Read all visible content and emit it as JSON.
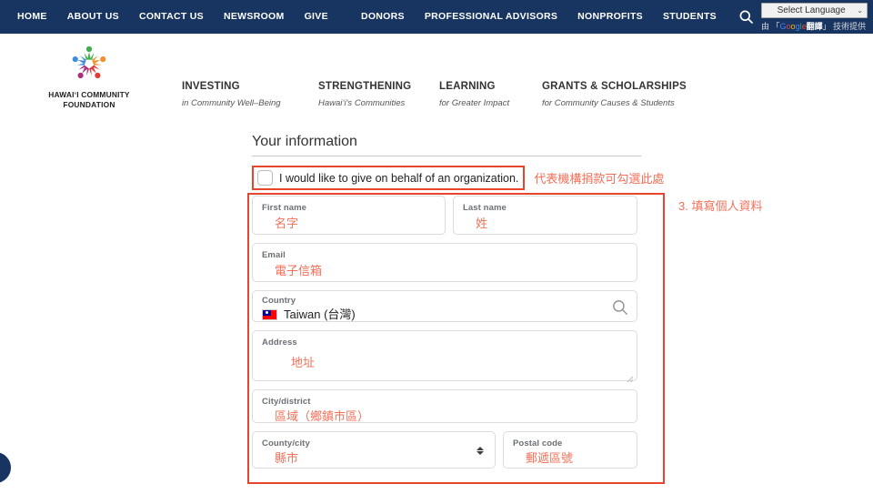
{
  "topnav": {
    "left_links": [
      "HOME",
      "ABOUT US",
      "CONTACT US",
      "NEWSROOM",
      "GIVE"
    ],
    "right_links": [
      "DONORS",
      "PROFESSIONAL ADVISORS",
      "NONPROFITS",
      "STUDENTS"
    ],
    "search_icon": "search-icon",
    "language": {
      "selected": "Select Language",
      "chevron": "⌄",
      "credit_prefix": "由 「",
      "credit_google": "Google",
      "credit_translate": "翻譯",
      "credit_suffix": "」 技術提供"
    },
    "bg_color": "#173560"
  },
  "header": {
    "logo": {
      "icon": "community-circle-logo",
      "line1": "HAWAIʻI COMMUNITY",
      "line2": "FOUNDATION"
    },
    "mainnav": [
      {
        "title": "INVESTING",
        "subtitle": "in Community Well–Being"
      },
      {
        "title": "STRENGTHENING",
        "subtitle": "Hawaiʻi's Communities"
      },
      {
        "title": "LEARNING",
        "subtitle": "for Greater Impact"
      },
      {
        "title": "GRANTS & SCHOLARSHIPS",
        "subtitle": "for Community Causes & Students"
      }
    ]
  },
  "form": {
    "section_title": "Your information",
    "organization": {
      "checkbox_checked": false,
      "label": "I would like to give on behalf of an organization.",
      "annotation": "代表機構捐款可勾選此處"
    },
    "step_annotation": "3. 填寫個人資料",
    "fields": {
      "first_name": {
        "label": "First name",
        "value": "名字"
      },
      "last_name": {
        "label": "Last name",
        "value": "姓"
      },
      "email": {
        "label": "Email",
        "value": "電子信箱"
      },
      "country": {
        "label": "Country",
        "value": "Taiwan (台灣)",
        "flag": "taiwan-flag-icon",
        "icon": "search-icon"
      },
      "address": {
        "label": "Address",
        "value": "地址",
        "icon": "resize-grip-icon"
      },
      "city_district": {
        "label": "City/district",
        "value": "區域（鄉鎮市區）"
      },
      "county_city": {
        "label": "County/city",
        "value": "縣市",
        "icon": "spinner-arrows-icon"
      },
      "postal_code": {
        "label": "Postal code",
        "value": "郵遞區號"
      }
    },
    "annotation_color": "#f4705a",
    "highlight_border_color": "#e8462c"
  },
  "widgets": {
    "chat_bubble": "chat-bubble-icon"
  }
}
